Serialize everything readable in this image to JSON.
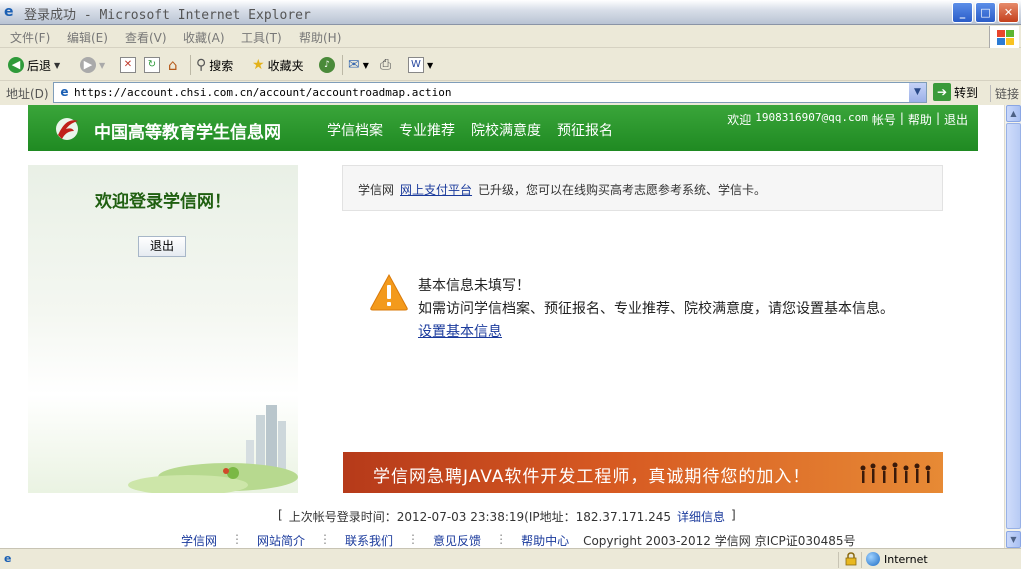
{
  "window": {
    "title": "登录成功 - Microsoft Internet Explorer",
    "controls": {
      "minimize": "_",
      "maximize": "□",
      "close": "✕"
    }
  },
  "menu": [
    "文件(F)",
    "编辑(E)",
    "查看(V)",
    "收藏(A)",
    "工具(T)",
    "帮助(H)"
  ],
  "toolbar": {
    "back": "后退",
    "search": "搜索",
    "favorites": "收藏夹"
  },
  "address": {
    "label": "地址(D)",
    "url": "https://account.chsi.com.cn/account/accountroadmap.action",
    "go": "转到",
    "links": "链接"
  },
  "site": {
    "name": "中国高等教育学生信息网",
    "nav": [
      "学信档案",
      "专业推荐",
      "院校满意度",
      "预征报名"
    ],
    "welcome_prefix": "欢迎",
    "email": "1908316907@qq.com",
    "account": "帐号",
    "help": "帮助",
    "exit": "退出",
    "sep": "|"
  },
  "left": {
    "welcome": "欢迎登录学信网！",
    "logout": "退出"
  },
  "notice": {
    "prefix": "学信网",
    "link": "网上支付平台",
    "suffix": "已升级，您可以在线购买高考志愿参考系统、学信卡。"
  },
  "warning": {
    "title": "基本信息未填写！",
    "desc": "如需访问学信档案、预征报名、专业推荐、院校满意度，请您设置基本信息。",
    "link": "设置基本信息"
  },
  "banner": {
    "text": "学信网急聘JAVA软件开发工程师，真诚期待您的加入！"
  },
  "last_login": {
    "open": "[",
    "text": "上次帐号登录时间：2012-07-03 23:38:19(IP地址：182.37.171.245",
    "details": "详细信息",
    "close": "]"
  },
  "footer": {
    "links": [
      "学信网",
      "网站简介",
      "联系我们",
      "意见反馈",
      "帮助中心"
    ],
    "divider": "⋮",
    "copyright": "Copyright 2003-2012 学信网 京ICP证030485号"
  },
  "status": {
    "zone": "Internet"
  },
  "colors": {
    "header_green": "#2a9a2e",
    "link_blue": "#1a3a9c",
    "banner_orange": "#d75a22",
    "warning_orange": "#f39a1c"
  }
}
